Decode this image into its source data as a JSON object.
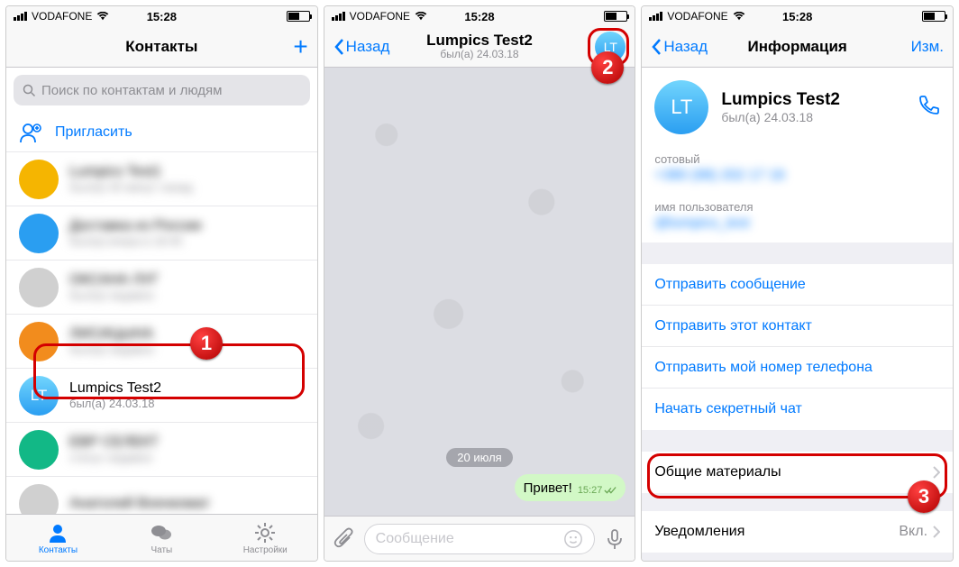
{
  "statusbar": {
    "carrier": "VODAFONE",
    "time": "15:28"
  },
  "screen1": {
    "title": "Контакты",
    "search_placeholder": "Поиск по контактам и людям",
    "invite": "Пригласить",
    "contacts": [
      {
        "name": "Lumpics Test1",
        "status": "был(а) 40 минут назад",
        "color": "#f5b501"
      },
      {
        "name": "Доставка из России",
        "status": "был(а) вчера в 18:45",
        "color": "#2a9ef1"
      },
      {
        "name": "ОКСАНА ЛУГ",
        "status": "был(а) недавно",
        "color": "#d0d0d0"
      },
      {
        "name": "ЛИСИЦЫНА",
        "status": "был(а) недавно",
        "color": "#f28c1d"
      },
      {
        "name": "Lumpics Test2",
        "status": "был(а) 24.03.18",
        "color": "avatar"
      },
      {
        "name": "ЕВР СЕЛЕКТ",
        "status": "статус недавно",
        "color": "#12b886"
      },
      {
        "name": "Анатолий Военкомат",
        "status": "",
        "color": "#d0d0d0"
      }
    ],
    "tabs": {
      "contacts": "Контакты",
      "chats": "Чаты",
      "settings": "Настройки"
    }
  },
  "screen2": {
    "back": "Назад",
    "title": "Lumpics Test2",
    "subtitle": "был(а) 24.03.18",
    "avatar_initials": "LT",
    "date": "20 июля",
    "message": "Привет!",
    "message_time": "15:27",
    "input_placeholder": "Сообщение"
  },
  "screen3": {
    "back": "Назад",
    "title": "Информация",
    "edit": "Изм.",
    "avatar_initials": "LT",
    "name": "Lumpics Test2",
    "status": "был(а) 24.03.18",
    "mobile_label": "сотовый",
    "mobile_value": "+380 (98) 202 17 16",
    "username_label": "имя пользователя",
    "username_value": "@lumpics_test",
    "actions": {
      "send_message": "Отправить сообщение",
      "send_contact": "Отправить этот контакт",
      "send_number": "Отправить мой номер телефона",
      "secret_chat": "Начать секретный чат"
    },
    "shared": "Общие материалы",
    "notifications_label": "Уведомления",
    "notifications_value": "Вкл."
  },
  "badges": {
    "b1": "1",
    "b2": "2",
    "b3": "3"
  }
}
